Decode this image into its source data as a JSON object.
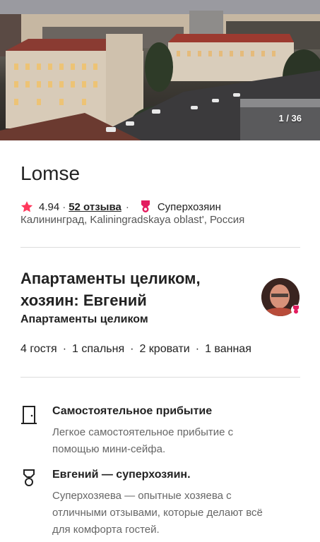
{
  "gallery": {
    "counter": "1 / 36"
  },
  "listing": {
    "title": "Lomse",
    "rating": "4.94",
    "separator": "·",
    "reviews_link": "52 отзыва",
    "superhost_label": "Суперхозяин",
    "location": "Калининград, Kaliningradskaya oblast', Россия"
  },
  "host": {
    "title": "Апартаменты целиком, хозяин: Евгений",
    "subtitle": "Апартаменты целиком",
    "details": [
      "4 гостя",
      "1 спальня",
      "2 кровати",
      "1 ванная"
    ]
  },
  "features": [
    {
      "icon": "door-icon",
      "title": "Самостоятельное прибытие",
      "description": "Легкое самостоятельное прибытие с помощью мини-сейфа."
    },
    {
      "icon": "medal-icon",
      "title": "Евгений — суперхозяин.",
      "description": "Суперхозяева — опытные хозяева с отличными отзывами, которые делают всё для комфорта гостей."
    }
  ],
  "colors": {
    "accent": "#ff385c",
    "superhost": "#e31c5f",
    "text": "#222222",
    "muted": "#666666",
    "divider": "#dddddd"
  }
}
